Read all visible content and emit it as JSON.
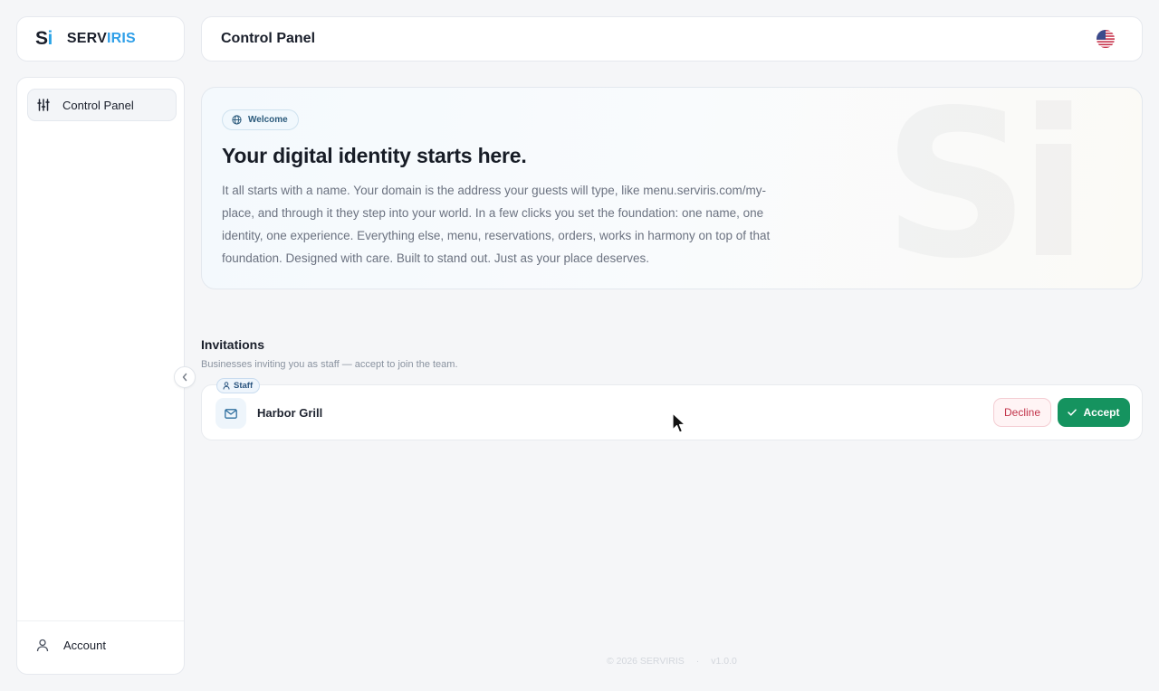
{
  "brand": {
    "mark_s": "S",
    "mark_i": "i",
    "name_prefix": "SERV",
    "name_suffix": "IRIS"
  },
  "header": {
    "title": "Control Panel",
    "language_icon": "us-flag-icon"
  },
  "sidebar": {
    "items": [
      {
        "label": "Control Panel",
        "icon": "sliders-icon"
      }
    ],
    "account": {
      "label": "Account",
      "icon": "user-icon"
    },
    "collapse_icon": "chevron-left-icon"
  },
  "welcome": {
    "badge": "Welcome",
    "title": "Your digital identity starts here.",
    "body": "It all starts with a name. Your domain is the address your guests will type, like menu.serviris.com/my-place, and through it they step into your world. In a few clicks you set the foundation: one name, one identity, one experience. Everything else, menu, reservations, orders, works in harmony on top of that foundation. Designed with care. Built to stand out. Just as your place deserves.",
    "watermark": "Si"
  },
  "invitations": {
    "title": "Invitations",
    "subtitle": "Businesses inviting you as staff — accept to join the team.",
    "items": [
      {
        "role": "Staff",
        "business": "Harbor Grill",
        "decline_label": "Decline",
        "accept_label": "Accept"
      }
    ]
  },
  "footer": {
    "copyright": "© 2026 SERVIRIS",
    "separator": "·",
    "version": "v1.0.0"
  },
  "colors": {
    "accent_blue": "#2f9fe8",
    "accept_green": "#15935f",
    "decline_red": "#c2334a",
    "background": "#f5f6f8"
  }
}
